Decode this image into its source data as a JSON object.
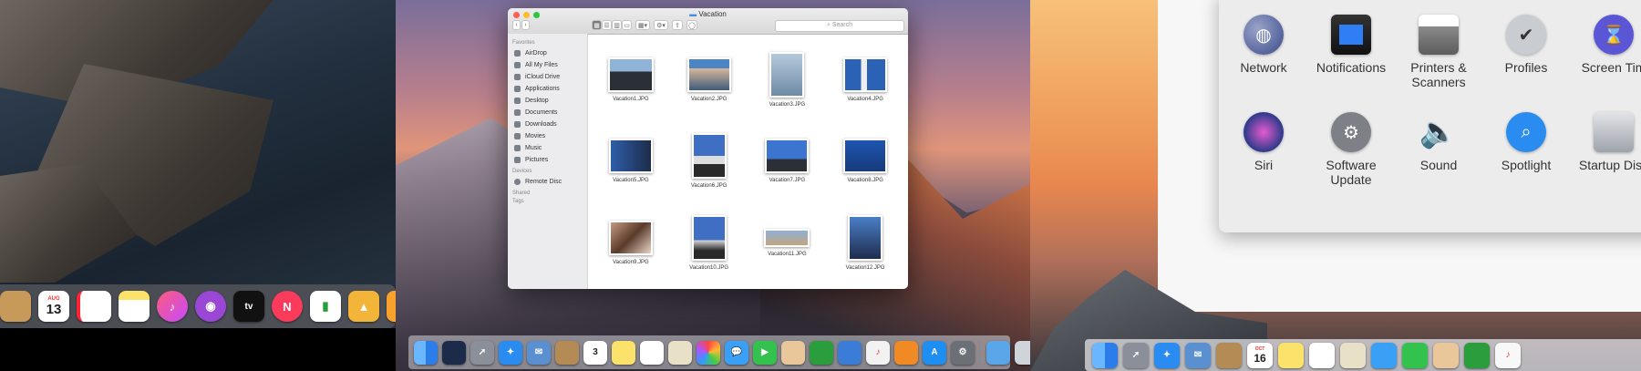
{
  "finder": {
    "title": "Vacation",
    "search_placeholder": "Search",
    "sidebar_sections": {
      "favorites": "Favorites",
      "devices": "Devices",
      "shared": "Shared",
      "tags": "Tags"
    },
    "favorites": [
      "AirDrop",
      "All My Files",
      "iCloud Drive",
      "Applications",
      "Desktop",
      "Documents",
      "Downloads",
      "Movies",
      "Music",
      "Pictures"
    ],
    "devices": [
      "Remote Disc"
    ],
    "files": [
      "Vacation1.JPG",
      "Vacation2.JPG",
      "Vacation3.JPG",
      "Vacation4.JPG",
      "Vacation5.JPG",
      "Vacation6.JPG",
      "Vacation7.JPG",
      "Vacation8.JPG",
      "Vacation9.JPG",
      "Vacation10.JPG",
      "Vacation11.JPG",
      "Vacation12.JPG"
    ]
  },
  "prefs": {
    "row1": [
      "Network",
      "Notifications",
      "Printers & Scanners",
      "Profiles",
      "Screen Tim"
    ],
    "row2": [
      "Siri",
      "Software Update",
      "Sound",
      "Spotlight",
      "Startup Disk"
    ]
  },
  "dock1": {
    "calendar_month": "AUG",
    "calendar_day": "13",
    "tv_label": "tv"
  },
  "dock2": {
    "calendar_day": "3"
  },
  "dock3": {
    "calendar_month": "OCT",
    "calendar_day": "16"
  },
  "colors": {
    "close": "#fc5f57",
    "minimize": "#fdbc2e",
    "zoom": "#29c840",
    "accent": "#2f7ef6"
  }
}
